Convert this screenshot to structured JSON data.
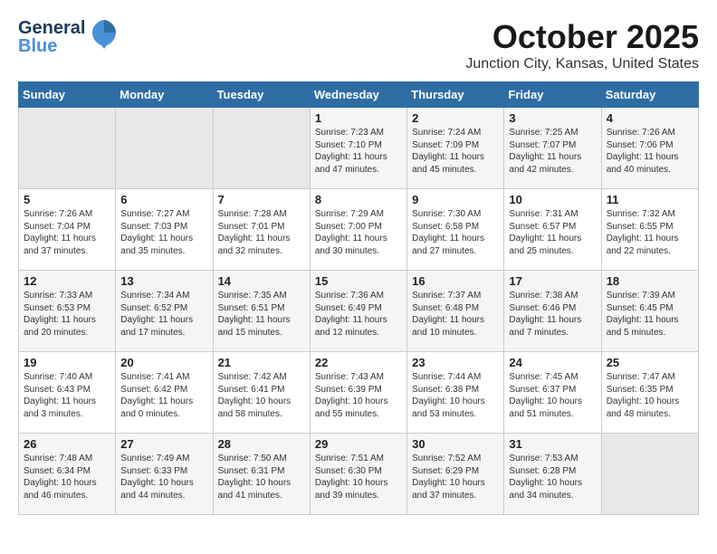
{
  "header": {
    "logo_line1": "General",
    "logo_line2": "Blue",
    "month": "October 2025",
    "location": "Junction City, Kansas, United States"
  },
  "weekdays": [
    "Sunday",
    "Monday",
    "Tuesday",
    "Wednesday",
    "Thursday",
    "Friday",
    "Saturday"
  ],
  "weeks": [
    [
      {
        "day": "",
        "content": ""
      },
      {
        "day": "",
        "content": ""
      },
      {
        "day": "",
        "content": ""
      },
      {
        "day": "1",
        "content": "Sunrise: 7:23 AM\nSunset: 7:10 PM\nDaylight: 11 hours\nand 47 minutes."
      },
      {
        "day": "2",
        "content": "Sunrise: 7:24 AM\nSunset: 7:09 PM\nDaylight: 11 hours\nand 45 minutes."
      },
      {
        "day": "3",
        "content": "Sunrise: 7:25 AM\nSunset: 7:07 PM\nDaylight: 11 hours\nand 42 minutes."
      },
      {
        "day": "4",
        "content": "Sunrise: 7:26 AM\nSunset: 7:06 PM\nDaylight: 11 hours\nand 40 minutes."
      }
    ],
    [
      {
        "day": "5",
        "content": "Sunrise: 7:26 AM\nSunset: 7:04 PM\nDaylight: 11 hours\nand 37 minutes."
      },
      {
        "day": "6",
        "content": "Sunrise: 7:27 AM\nSunset: 7:03 PM\nDaylight: 11 hours\nand 35 minutes."
      },
      {
        "day": "7",
        "content": "Sunrise: 7:28 AM\nSunset: 7:01 PM\nDaylight: 11 hours\nand 32 minutes."
      },
      {
        "day": "8",
        "content": "Sunrise: 7:29 AM\nSunset: 7:00 PM\nDaylight: 11 hours\nand 30 minutes."
      },
      {
        "day": "9",
        "content": "Sunrise: 7:30 AM\nSunset: 6:58 PM\nDaylight: 11 hours\nand 27 minutes."
      },
      {
        "day": "10",
        "content": "Sunrise: 7:31 AM\nSunset: 6:57 PM\nDaylight: 11 hours\nand 25 minutes."
      },
      {
        "day": "11",
        "content": "Sunrise: 7:32 AM\nSunset: 6:55 PM\nDaylight: 11 hours\nand 22 minutes."
      }
    ],
    [
      {
        "day": "12",
        "content": "Sunrise: 7:33 AM\nSunset: 6:53 PM\nDaylight: 11 hours\nand 20 minutes."
      },
      {
        "day": "13",
        "content": "Sunrise: 7:34 AM\nSunset: 6:52 PM\nDaylight: 11 hours\nand 17 minutes."
      },
      {
        "day": "14",
        "content": "Sunrise: 7:35 AM\nSunset: 6:51 PM\nDaylight: 11 hours\nand 15 minutes."
      },
      {
        "day": "15",
        "content": "Sunrise: 7:36 AM\nSunset: 6:49 PM\nDaylight: 11 hours\nand 12 minutes."
      },
      {
        "day": "16",
        "content": "Sunrise: 7:37 AM\nSunset: 6:48 PM\nDaylight: 11 hours\nand 10 minutes."
      },
      {
        "day": "17",
        "content": "Sunrise: 7:38 AM\nSunset: 6:46 PM\nDaylight: 11 hours\nand 7 minutes."
      },
      {
        "day": "18",
        "content": "Sunrise: 7:39 AM\nSunset: 6:45 PM\nDaylight: 11 hours\nand 5 minutes."
      }
    ],
    [
      {
        "day": "19",
        "content": "Sunrise: 7:40 AM\nSunset: 6:43 PM\nDaylight: 11 hours\nand 3 minutes."
      },
      {
        "day": "20",
        "content": "Sunrise: 7:41 AM\nSunset: 6:42 PM\nDaylight: 11 hours\nand 0 minutes."
      },
      {
        "day": "21",
        "content": "Sunrise: 7:42 AM\nSunset: 6:41 PM\nDaylight: 10 hours\nand 58 minutes."
      },
      {
        "day": "22",
        "content": "Sunrise: 7:43 AM\nSunset: 6:39 PM\nDaylight: 10 hours\nand 55 minutes."
      },
      {
        "day": "23",
        "content": "Sunrise: 7:44 AM\nSunset: 6:38 PM\nDaylight: 10 hours\nand 53 minutes."
      },
      {
        "day": "24",
        "content": "Sunrise: 7:45 AM\nSunset: 6:37 PM\nDaylight: 10 hours\nand 51 minutes."
      },
      {
        "day": "25",
        "content": "Sunrise: 7:47 AM\nSunset: 6:35 PM\nDaylight: 10 hours\nand 48 minutes."
      }
    ],
    [
      {
        "day": "26",
        "content": "Sunrise: 7:48 AM\nSunset: 6:34 PM\nDaylight: 10 hours\nand 46 minutes."
      },
      {
        "day": "27",
        "content": "Sunrise: 7:49 AM\nSunset: 6:33 PM\nDaylight: 10 hours\nand 44 minutes."
      },
      {
        "day": "28",
        "content": "Sunrise: 7:50 AM\nSunset: 6:31 PM\nDaylight: 10 hours\nand 41 minutes."
      },
      {
        "day": "29",
        "content": "Sunrise: 7:51 AM\nSunset: 6:30 PM\nDaylight: 10 hours\nand 39 minutes."
      },
      {
        "day": "30",
        "content": "Sunrise: 7:52 AM\nSunset: 6:29 PM\nDaylight: 10 hours\nand 37 minutes."
      },
      {
        "day": "31",
        "content": "Sunrise: 7:53 AM\nSunset: 6:28 PM\nDaylight: 10 hours\nand 34 minutes."
      },
      {
        "day": "",
        "content": ""
      }
    ]
  ]
}
